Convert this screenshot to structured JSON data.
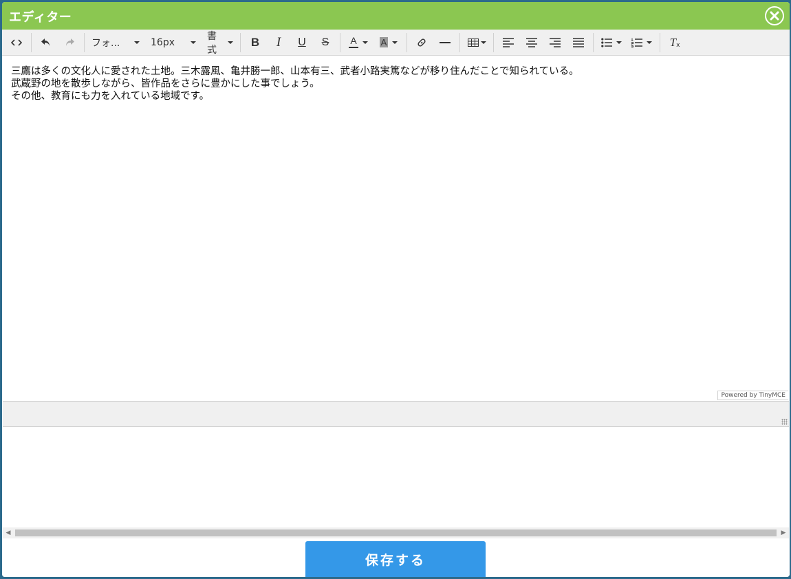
{
  "dialog": {
    "title": "エディター",
    "colors": {
      "titlebar": "#8bc751",
      "save_button": "#3498e8"
    }
  },
  "toolbar": {
    "font_family_label": "フォ...",
    "font_size_label": "16px",
    "format_label": "書式",
    "icons": [
      "source-code-icon",
      "undo-icon",
      "redo-icon",
      "bold-icon",
      "italic-icon",
      "underline-icon",
      "strikethrough-icon",
      "text-color-icon",
      "background-color-icon",
      "link-icon",
      "horizontal-rule-icon",
      "table-icon",
      "align-left-icon",
      "align-center-icon",
      "align-right-icon",
      "align-justify-icon",
      "bullet-list-icon",
      "numbered-list-icon",
      "clear-formatting-icon"
    ],
    "bold_glyph": "B",
    "italic_glyph": "I",
    "underline_glyph": "U",
    "strike_glyph": "S",
    "text_color_glyph": "A",
    "bg_color_glyph": "A",
    "clear_format_glyph": "T"
  },
  "content": {
    "lines": [
      "三鷹は多くの文化人に愛された土地。三木露風、亀井勝一郎、山本有三、武者小路実篤などが移り住んだことで知られている。",
      "武蔵野の地を散歩しながら、皆作品をさらに豊かにした事でしょう。",
      "その他、教育にも力を入れている地域です。"
    ]
  },
  "branding": {
    "powered_by": "Powered by TinyMCE"
  },
  "footer": {
    "save_label": "保存する"
  }
}
